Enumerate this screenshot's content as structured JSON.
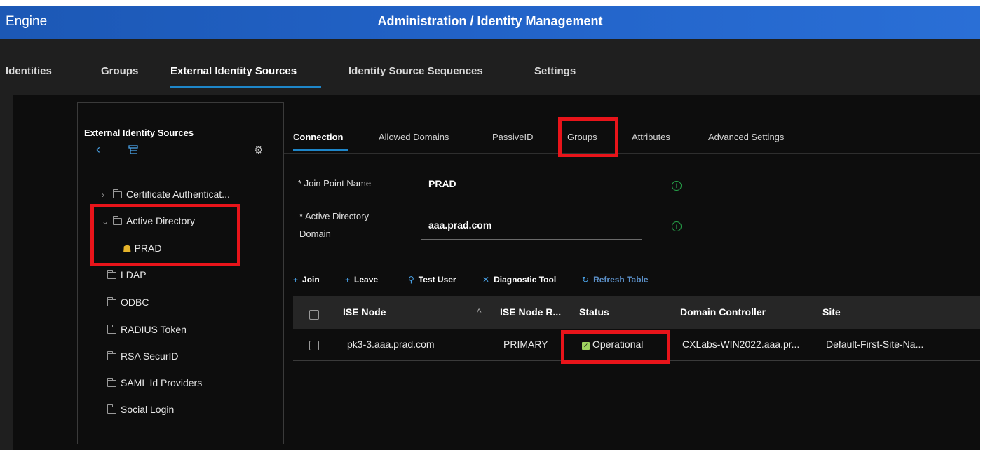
{
  "window": {
    "app_name": "Engine",
    "title": "Administration / Identity Management"
  },
  "top_tabs": [
    {
      "label": "Identities"
    },
    {
      "label": "Groups"
    },
    {
      "label": "External Identity Sources",
      "active": true
    },
    {
      "label": "Identity Source Sequences"
    },
    {
      "label": "Settings"
    }
  ],
  "sidebar": {
    "title": "External Identity Sources",
    "items": [
      {
        "label": "Certificate Authenticat..."
      },
      {
        "label": "Active Directory"
      },
      {
        "label": "PRAD"
      },
      {
        "label": "LDAP"
      },
      {
        "label": "ODBC"
      },
      {
        "label": "RADIUS Token"
      },
      {
        "label": "RSA SecurID"
      },
      {
        "label": "SAML Id Providers"
      },
      {
        "label": "Social Login"
      }
    ]
  },
  "sub_tabs": [
    {
      "label": "Connection",
      "active": true
    },
    {
      "label": "Allowed Domains"
    },
    {
      "label": "PassiveID"
    },
    {
      "label": "Groups"
    },
    {
      "label": "Attributes"
    },
    {
      "label": "Advanced Settings"
    }
  ],
  "form": {
    "join_point_label": "* Join Point Name",
    "join_point_value": "PRAD",
    "ad_domain_label_1": "* Active Directory",
    "ad_domain_label_2": "Domain",
    "ad_domain_value": "aaa.prad.com"
  },
  "toolbar": {
    "join": "Join",
    "leave": "Leave",
    "test_user": "Test User",
    "diagnostic_tool": "Diagnostic Tool",
    "refresh_table": "Refresh Table"
  },
  "table": {
    "headers": [
      "ISE Node",
      "ISE Node R...",
      "Status",
      "Domain Controller",
      "Site"
    ],
    "rows": [
      [
        "pk3-3.aaa.prad.com",
        "PRIMARY",
        "Operational",
        "CXLabs-WIN2022.aaa.pr...",
        "Default-First-Site-Na..."
      ]
    ]
  },
  "colors": {
    "accent": "#1e86c9",
    "highlight": "#e8141a",
    "status_ok": "#9ed35e"
  }
}
